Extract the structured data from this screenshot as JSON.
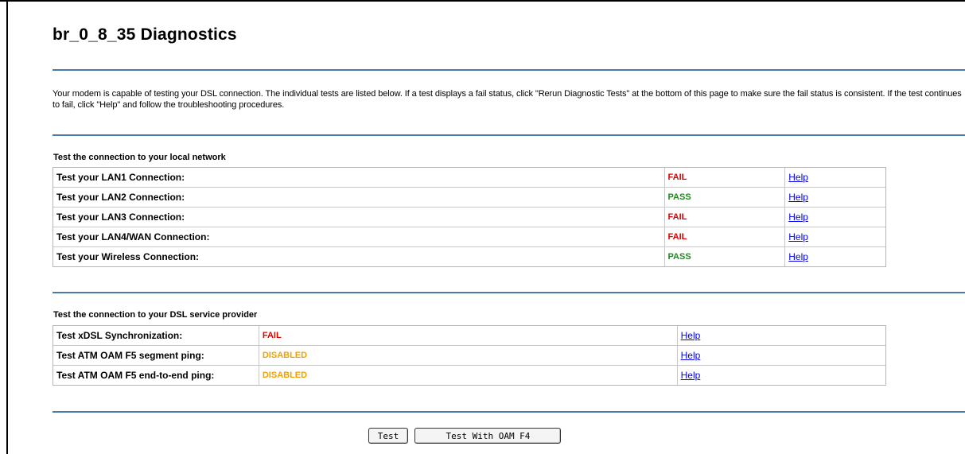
{
  "page": {
    "title": "br_0_8_35 Diagnostics",
    "intro": "Your modem is capable of testing your DSL connection. The individual tests are listed below. If a test displays a fail status, click \"Rerun Diagnostic Tests\" at the bottom of this page to make sure the fail status is consistent. If the test continues to fail, click \"Help\" and follow the troubleshooting procedures."
  },
  "local_network": {
    "title": "Test the connection to your local network",
    "rows": [
      {
        "label": "Test your LAN1 Connection:",
        "status": "FAIL",
        "help": "Help"
      },
      {
        "label": "Test your LAN2 Connection:",
        "status": "PASS",
        "help": "Help"
      },
      {
        "label": "Test your LAN3 Connection:",
        "status": "FAIL",
        "help": "Help"
      },
      {
        "label": "Test your LAN4/WAN Connection:",
        "status": "FAIL",
        "help": "Help"
      },
      {
        "label": "Test your Wireless Connection:",
        "status": "PASS",
        "help": "Help"
      }
    ]
  },
  "dsl_provider": {
    "title": "Test the connection to your DSL service provider",
    "rows": [
      {
        "label": "Test xDSL Synchronization:",
        "status": "FAIL",
        "help": "Help"
      },
      {
        "label": "Test ATM OAM F5 segment ping:",
        "status": "DISABLED",
        "help": "Help"
      },
      {
        "label": "Test ATM OAM F5 end-to-end ping:",
        "status": "DISABLED",
        "help": "Help"
      }
    ]
  },
  "buttons": {
    "test": "Test",
    "test_oam_f4": "Test With OAM F4"
  },
  "colors": {
    "fail": "#e00000",
    "pass": "#1d8a1d",
    "disabled": "#f0a000",
    "divider": "#4b7aa8",
    "link": "#0000ee"
  }
}
